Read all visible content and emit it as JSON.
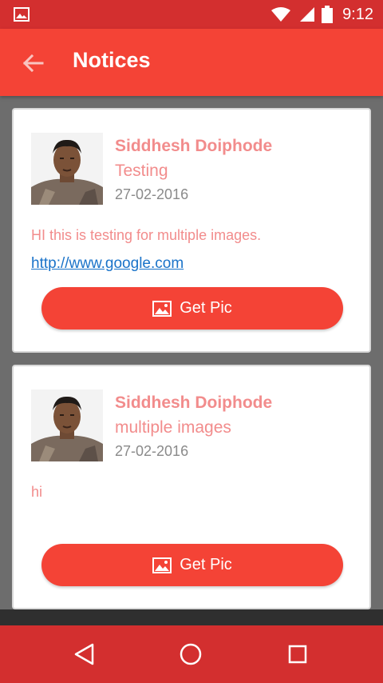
{
  "status_bar": {
    "time": "9:12",
    "icons": [
      "gallery-icon",
      "wifi-icon",
      "signal-icon",
      "battery-icon"
    ]
  },
  "app_bar": {
    "title": "Notices",
    "back_icon": "arrow-back-icon"
  },
  "notices": [
    {
      "author": "Siddhesh Doiphode",
      "subject": "Testing",
      "date": "27-02-2016",
      "message": "HI this is testing for multiple images.",
      "link": "http://www.google.com",
      "button_label": "Get Pic",
      "button_icon": "image-icon"
    },
    {
      "author": "Siddhesh Doiphode",
      "subject": "multiple images",
      "date": "27-02-2016",
      "message": "hi",
      "link": "",
      "button_label": "Get Pic",
      "button_icon": "image-icon"
    }
  ],
  "nav_bar": {
    "icons": [
      "back-triangle-icon",
      "home-circle-icon",
      "recents-square-icon"
    ]
  },
  "colors": {
    "primary": "#f44336",
    "primary_dark": "#d32f2f",
    "accent_text": "#f28c8c",
    "date_text": "#8a8a8a",
    "link": "#1a73c9",
    "background": "#6d6d6d"
  }
}
